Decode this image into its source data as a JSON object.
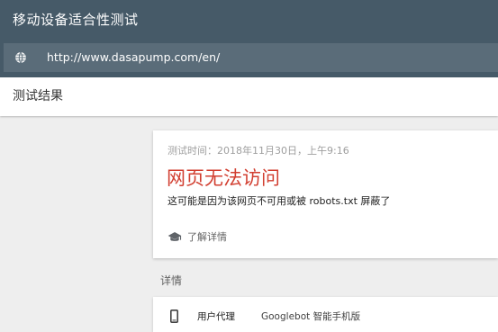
{
  "app": {
    "title": "移动设备适合性测试"
  },
  "url_bar": {
    "icon": "globe-icon",
    "url": "http://www.dasapump.com/en/"
  },
  "results": {
    "title": "测试结果"
  },
  "result_card": {
    "test_time": "测试时间：2018年11月30日，上午9:16",
    "heading": "网页无法访问",
    "description": "这可能是因为该网页不可用或被 robots.txt 屏蔽了",
    "learn_more_icon": "school-cap-icon",
    "learn_more_label": "了解详情",
    "heading_color": "#d23f31"
  },
  "details": {
    "label": "详情",
    "rows": [
      {
        "icon": "phone-icon",
        "label": "用户代理",
        "value": "Googlebot 智能手机版"
      }
    ]
  },
  "colors": {
    "topbar": "#465a68",
    "url_bar": "#5a6c79",
    "background": "#eeeeee"
  }
}
